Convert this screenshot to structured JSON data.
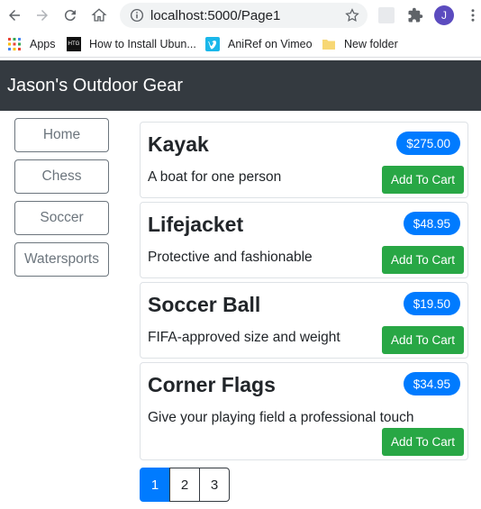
{
  "browser": {
    "url": "localhost:5000/Page1",
    "avatar_letter": "J",
    "bookmarks": [
      "Apps",
      "How to Install Ubun...",
      "AniRef on Vimeo",
      "New folder"
    ]
  },
  "app": {
    "title": "Jason's Outdoor Gear"
  },
  "categories": [
    "Home",
    "Chess",
    "Soccer",
    "Watersports"
  ],
  "products": [
    {
      "name": "Kayak",
      "price": "$275.00",
      "description": "A boat for one person",
      "cart_label": "Add To Cart"
    },
    {
      "name": "Lifejacket",
      "price": "$48.95",
      "description": "Protective and fashionable",
      "cart_label": "Add To Cart"
    },
    {
      "name": "Soccer Ball",
      "price": "$19.50",
      "description": "FIFA-approved size and weight",
      "cart_label": "Add To Cart"
    },
    {
      "name": "Corner Flags",
      "price": "$34.95",
      "description": "Give your playing field a professional touch",
      "cart_label": "Add To Cart"
    }
  ],
  "pagination": {
    "pages": [
      "1",
      "2",
      "3"
    ],
    "active": "1"
  },
  "colors": {
    "header_bg": "#343a40",
    "badge": "#007bff",
    "cart_button": "#28a745",
    "active_page": "#007bff"
  }
}
